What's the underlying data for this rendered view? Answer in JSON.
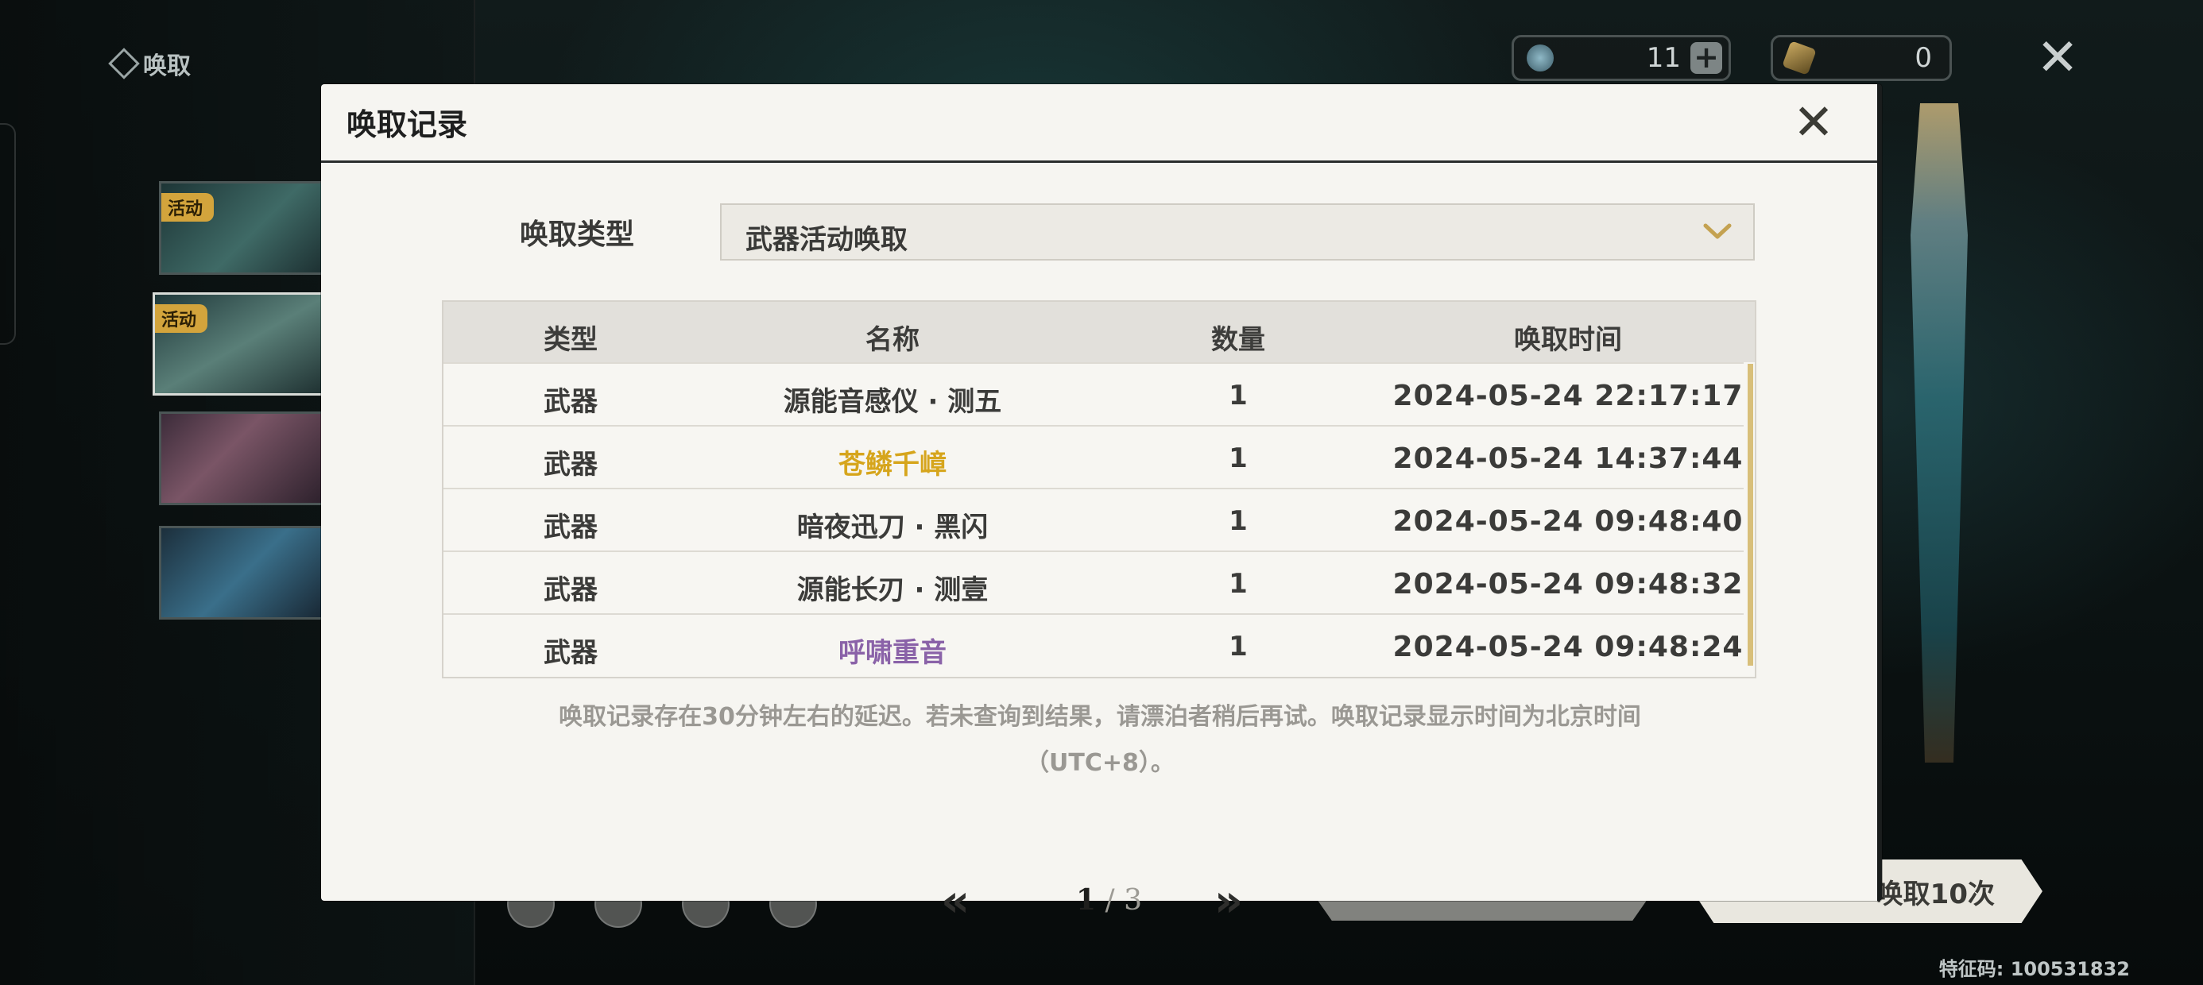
{
  "nav": {
    "title": "唤取"
  },
  "banners": [
    {
      "tag": "活动"
    },
    {
      "tag": "活动"
    },
    {
      "tag": ""
    },
    {
      "tag": ""
    }
  ],
  "currencies": [
    {
      "icon": "astrite-icon",
      "value": "11"
    },
    {
      "icon": "forging-tide-icon",
      "value": "0"
    }
  ],
  "modal": {
    "title": "唤取记录",
    "type_label": "唤取类型",
    "type_selected": "武器活动唤取",
    "columns": [
      "类型",
      "名称",
      "数量",
      "唤取时间"
    ],
    "rows": [
      {
        "type": "武器",
        "name": "源能音感仪 · 测五",
        "qty": "1",
        "time": "2024-05-24 22:17:17",
        "name_color": "#3b3b39"
      },
      {
        "type": "武器",
        "name": "苍鳞千嶂",
        "qty": "1",
        "time": "2024-05-24 14:37:44",
        "name_color": "#d6a51c"
      },
      {
        "type": "武器",
        "name": "暗夜迅刀 · 黑闪",
        "qty": "1",
        "time": "2024-05-24 09:48:40",
        "name_color": "#3b3b39"
      },
      {
        "type": "武器",
        "name": "源能长刃 · 测壹",
        "qty": "1",
        "time": "2024-05-24 09:48:32",
        "name_color": "#3b3b39"
      },
      {
        "type": "武器",
        "name": "呼啸重音",
        "qty": "1",
        "time": "2024-05-24 09:48:24",
        "name_color": "#8a62a8"
      }
    ],
    "notice_line1": "唤取记录存在30分钟左右的延迟。若未查询到结果，请漂泊者稍后再试。唤取记录显示时间为北京时间",
    "notice_line2": "（UTC+8）。",
    "pagination": {
      "prev": "«",
      "next": "»",
      "current": "1",
      "separator": "/",
      "total": "3"
    }
  },
  "actions": {
    "ten_pull_label": "唤取10次"
  },
  "footer": {
    "feature_code": "特征码: 100531832"
  },
  "colors": {
    "accent_gold": "#d6a51c",
    "scrollbar": "#d8bf7a",
    "rare_purple": "#8a62a8"
  }
}
